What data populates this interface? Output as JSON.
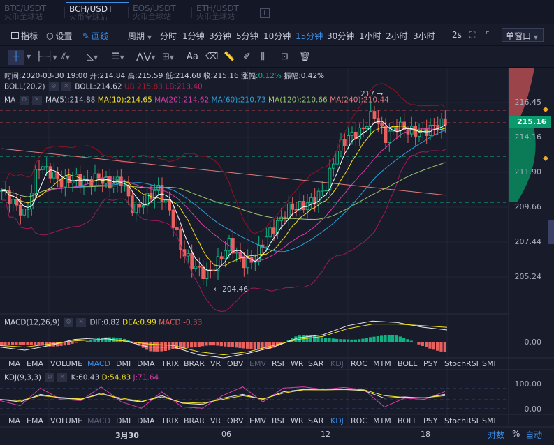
{
  "tabs": [
    {
      "pair": "BTC/USDT",
      "exchange": "火币全球站"
    },
    {
      "pair": "BCH/USDT",
      "exchange": "火币全球站"
    },
    {
      "pair": "EOS/USDT",
      "exchange": "火币全球站"
    },
    {
      "pair": "ETH/USDT",
      "exchange": "火币全球站"
    }
  ],
  "toolbar": {
    "indicator": "指标",
    "settings": "设置",
    "draw": "画线",
    "period": "周期",
    "periods": [
      "分时",
      "1分钟",
      "3分钟",
      "5分钟",
      "10分钟",
      "15分钟",
      "30分钟",
      "1小时",
      "2小时",
      "3小时"
    ],
    "active_period": "15分钟",
    "refresh": "2s",
    "window": "单窗口"
  },
  "drawtools": {
    "text": "Aa"
  },
  "info": {
    "time": "时间:2020-03-30 19:00",
    "open": "开:214.84",
    "high": "高:215.59",
    "low": "低:214.68",
    "close": "收:215.16",
    "change_label": "涨幅:",
    "change": "0.12%",
    "amp": "振幅:0.42%"
  },
  "boll": {
    "label": "BOLL(20,2)",
    "boll": "BOLL:214.62",
    "ub": "UB:215.83",
    "lb": "LB:213.40"
  },
  "ma": {
    "label": "MA",
    "ma5": "MA(5):214.88",
    "ma10": "MA(10):214.65",
    "ma20": "MA(20):214.62",
    "ma60": "MA(60):210.73",
    "ma120": "MA(120):210.66",
    "ma240": "MA(240):210.44"
  },
  "annotations": {
    "high": "217",
    "low": "204.46"
  },
  "price_axis": [
    "216.45",
    "214.16",
    "211.90",
    "209.66",
    "207.44",
    "205.24"
  ],
  "current_price": "215.16",
  "macd": {
    "label": "MACD(12,26,9)",
    "dif": "DIF:0.82",
    "dea": "DEA:0.99",
    "macd": "MACD:-0.33",
    "axis": "0.00"
  },
  "kdj": {
    "label": "KDJ(9,3,3)",
    "k": "K:60.43",
    "d": "D:54.83",
    "j": "J:71.64",
    "axis": [
      "100.00",
      "0.00"
    ]
  },
  "indicator_tabs": [
    "MA",
    "EMA",
    "VOLUME",
    "MACD",
    "DMI",
    "DMA",
    "TRIX",
    "BRAR",
    "VR",
    "OBV",
    "EMV",
    "RSI",
    "WR",
    "SAR",
    "KDJ",
    "ROC",
    "MTM",
    "BOLL",
    "PSY",
    "StochRSI",
    "SMI"
  ],
  "dates": [
    "3月30",
    "06",
    "12",
    "18"
  ],
  "bottom": {
    "log": "对数",
    "pct": "%",
    "auto": "自动"
  },
  "colors": {
    "up": "#0fb383",
    "down": "#e8615f",
    "accent": "#3b8ee8"
  },
  "chart_data": {
    "type": "candlestick",
    "price_keypoints": [
      210.8,
      210,
      209.2,
      212.5,
      212,
      211.3,
      211.6,
      211.3,
      211.7,
      211.2,
      211.5,
      209.5,
      210.2,
      211,
      209.5,
      207,
      206,
      205.4,
      206.2,
      207.5,
      206.2,
      206.3,
      207.8,
      208.7,
      209.7,
      209.8,
      210.2,
      211,
      213.5,
      214.3,
      214.6,
      215.8,
      214.2,
      215,
      214.6,
      214.5,
      214.9,
      215.16
    ],
    "ylim": [
      204,
      217.5
    ],
    "macd_dif": [
      -0.3,
      -0.5,
      -0.2,
      0.2,
      0.3,
      0.1,
      -0.3,
      -0.3,
      -0.8,
      -1.0,
      -0.7,
      -0.3,
      0.3,
      0.5,
      1.1,
      1.4,
      1.3,
      1.0,
      0.82
    ],
    "macd_dea": [
      -0.2,
      -0.3,
      -0.1,
      0.1,
      0.2,
      0.1,
      -0.1,
      -0.2,
      -0.6,
      -0.8,
      -0.6,
      -0.2,
      0.2,
      0.4,
      0.9,
      1.2,
      1.2,
      1.1,
      0.99
    ],
    "k": [
      40,
      30,
      60,
      45,
      40,
      65,
      40,
      30,
      55,
      25,
      20,
      45,
      60,
      40,
      70,
      80,
      78,
      80,
      75,
      45,
      50,
      45,
      60.43
    ],
    "d": [
      40,
      35,
      55,
      48,
      42,
      60,
      45,
      32,
      50,
      28,
      25,
      40,
      55,
      42,
      65,
      78,
      78,
      79,
      78,
      55,
      48,
      47,
      54.83
    ],
    "j": [
      35,
      15,
      85,
      40,
      35,
      90,
      30,
      5,
      70,
      10,
      5,
      55,
      90,
      30,
      85,
      90,
      80,
      88,
      78,
      10,
      45,
      40,
      71.64
    ]
  }
}
